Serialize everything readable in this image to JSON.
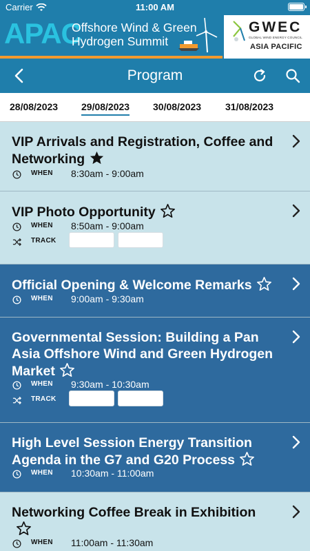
{
  "status_bar": {
    "carrier": "Carrier",
    "time": "11:00 AM"
  },
  "banner": {
    "apac": "APAC",
    "line1": "Offshore Wind & Green",
    "line2": "Hydrogen Summit",
    "partner_title": "GWEC",
    "partner_sub": "GLOBAL WIND ENERGY COUNCIL",
    "partner_region": "ASIA PACIFIC",
    "colors": {
      "primary": "#1f7eab",
      "accent": "#2ac2e0",
      "stripe": "#f29a2e"
    }
  },
  "navbar": {
    "title": "Program",
    "back_icon": "chevron-left-icon",
    "refresh_icon": "refresh-icon",
    "search_icon": "search-icon"
  },
  "dates": [
    "28/08/2023",
    "29/08/2023",
    "30/08/2023",
    "31/08/2023"
  ],
  "selected_date": "29/08/2023",
  "sessions": [
    {
      "title": "VIP Arrivals and Registration, Coffee and Networking",
      "starred": true,
      "when_label": "WHEN",
      "when": "8:30am - 9:00am",
      "theme": "light"
    },
    {
      "title": "VIP Photo Opportunity",
      "starred": false,
      "when_label": "WHEN",
      "when": "8:50am - 9:00am",
      "track_label": "TRACK",
      "theme": "light"
    },
    {
      "title": "Official Opening & Welcome Remarks",
      "starred": false,
      "when_label": "WHEN",
      "when": "9:00am - 9:30am",
      "theme": "dark"
    },
    {
      "title": "Governmental Session: Building a Pan Asia Offshore Wind and Green Hydrogen Market",
      "starred": false,
      "when_label": "WHEN",
      "when": "9:30am - 10:30am",
      "track_label": "TRACK",
      "theme": "dark"
    },
    {
      "title": "High Level Session Energy Transition Agenda in the G7 and G20 Process",
      "starred": false,
      "when_label": "WHEN",
      "when": "10:30am - 11:00am",
      "theme": "dark"
    },
    {
      "title": "Networking Coffee Break in Exhibition",
      "starred": false,
      "when_label": "WHEN",
      "when": "11:00am - 11:30am",
      "theme": "light"
    }
  ]
}
